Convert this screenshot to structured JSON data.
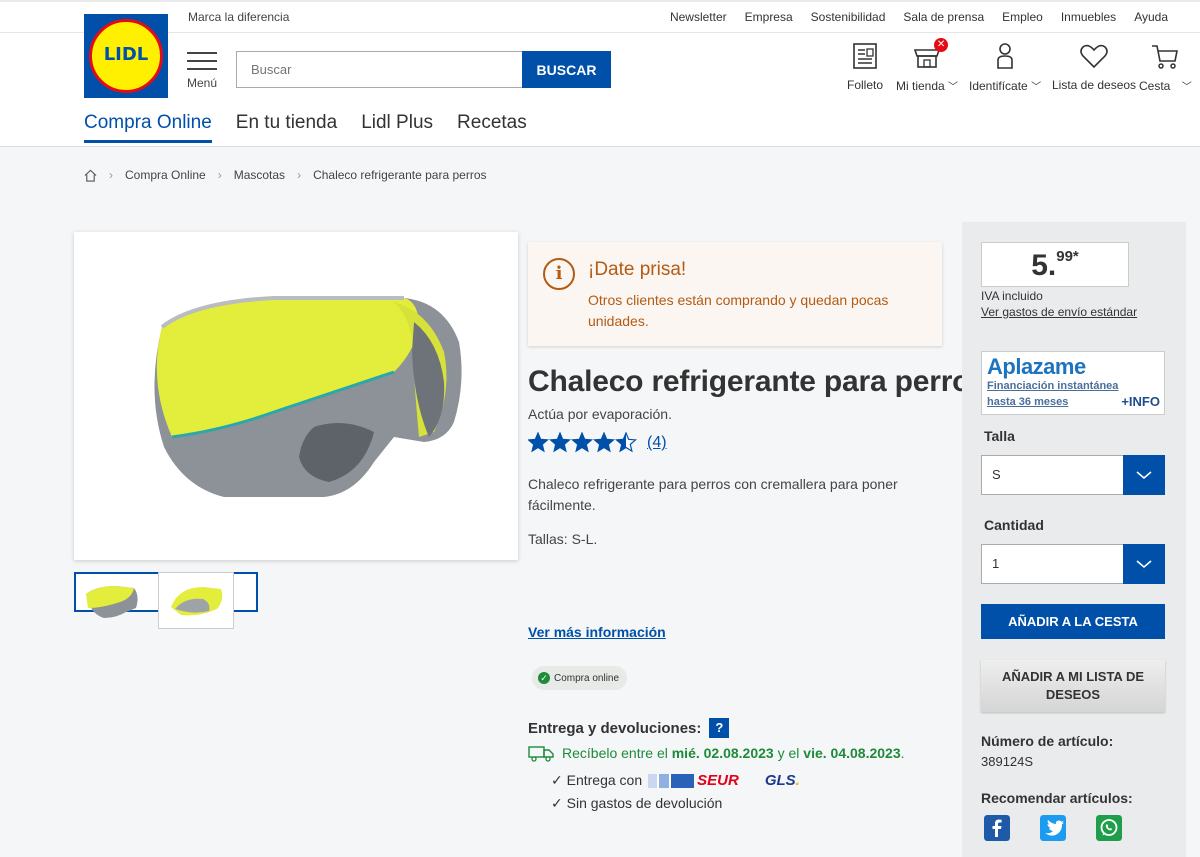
{
  "header": {
    "tagline": "Marca la diferencia",
    "top_links": [
      "Newsletter",
      "Empresa",
      "Sostenibilidad",
      "Sala de prensa",
      "Empleo",
      "Inmuebles",
      "Ayuda"
    ],
    "logo_text": "LIDL",
    "menu_label": "Menú",
    "search_placeholder": "Buscar",
    "search_button": "BUSCAR",
    "icons": {
      "folleto": "Folleto",
      "mi_tienda": "Mi tienda",
      "identificate": "Identifícate",
      "lista_deseos": "Lista de deseos",
      "cesta": "Cesta"
    },
    "nav": [
      "Compra Online",
      "En tu tienda",
      "Lidl Plus",
      "Recetas"
    ]
  },
  "breadcrumb": [
    "Compra Online",
    "Mascotas",
    "Chaleco refrigerante para perros"
  ],
  "hurry": {
    "title": "¡Date prisa!",
    "text": "Otros clientes están comprando y quedan pocas unidades."
  },
  "product": {
    "title": "Chaleco refrigerante para perros",
    "subtitle": "Actúa por evaporación.",
    "rating": 4.5,
    "rating_count": "(4)",
    "description": "Chaleco refrigerante para perros con cremallera para poner fácilmente.",
    "sizes": "Tallas: S-L.",
    "more_info": "Ver más información",
    "badge": "Compra online"
  },
  "delivery": {
    "heading": "Entrega y devoluciones:",
    "help": "?",
    "date_prefix": "Recíbelo entre el",
    "date_from": "mié. 02.08.2023",
    "date_mid": "y el",
    "date_to": "vie. 04.08.2023",
    "date_suffix": ".",
    "line1": "✓ Entrega con",
    "carrier1": "SEUR",
    "carrier2": "GLS",
    "line2": "✓ Sin gastos de devolución"
  },
  "sidebar": {
    "price_int": "5.",
    "price_dec": "99*",
    "iva": "IVA incluido",
    "shipping": "Ver gastos de envío estándar",
    "aplazame": {
      "brand": "Aplazame",
      "line1": "Financiación instantánea",
      "line2": "hasta 36 meses",
      "info": "+INFO"
    },
    "talla_label": "Talla",
    "talla_value": "S",
    "cantidad_label": "Cantidad",
    "cantidad_value": "1",
    "add_cart": "AÑADIR A LA CESTA",
    "add_wishlist": "AÑADIR A MI LISTA DE DESEOS",
    "article_label": "Número de artículo:",
    "article_number": "389124S",
    "recommend_label": "Recomendar artículos:"
  },
  "colors": {
    "brand_blue": "#0050aa",
    "lidl_yellow": "#fff000",
    "lidl_red": "#e60a14",
    "hurry_orange": "#b35b13",
    "delivery_green": "#1e8a3a"
  }
}
